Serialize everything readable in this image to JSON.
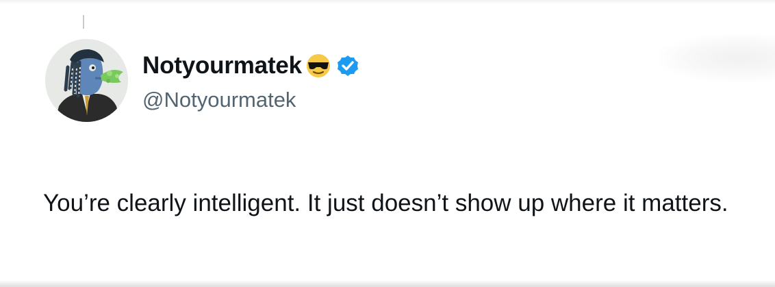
{
  "tweet": {
    "display_name": "Notyourmatek",
    "handle": "@Notyourmatek",
    "name_emoji": "smiling-face-with-sunglasses-icon",
    "verified": true,
    "verified_color": "#1d9bf0",
    "text": "You’re clearly intelligent. It just doesn’t show up where it matters."
  },
  "colors": {
    "background": "#ffffff",
    "text_primary": "#0f1419",
    "text_secondary": "#536471"
  }
}
